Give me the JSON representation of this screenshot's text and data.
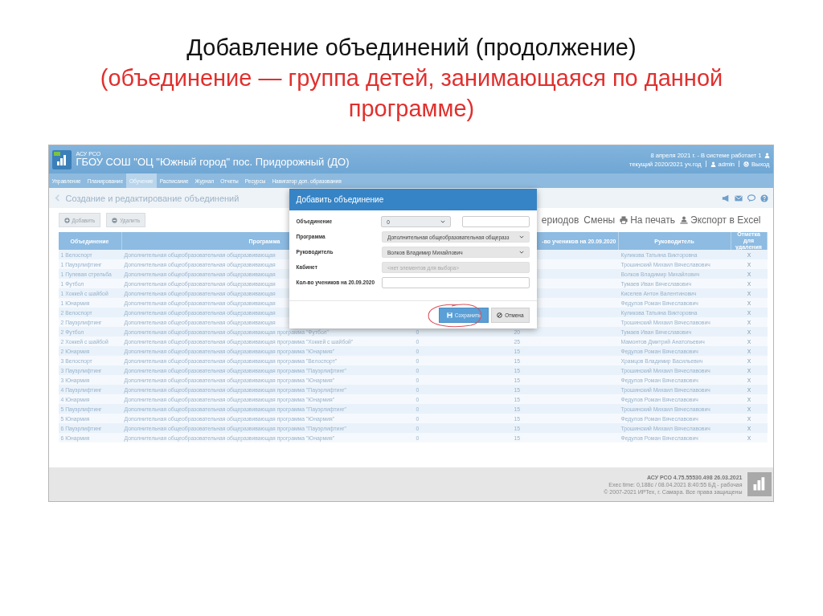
{
  "slide": {
    "title": "Добавление объединений (продолжение)",
    "subtitle": "(объединение — группа детей, занимающаяся по данной программе)"
  },
  "header": {
    "system": "АСУ РСО",
    "school": "ГБОУ СОШ \"ОЦ \"Южный город\" пос. Придорожный (ДО)",
    "status": "8 апреля 2021 г. - В системе работает 1",
    "year": "текущий 2020/2021 уч.год",
    "user": "admin",
    "logout": "Выход"
  },
  "nav": [
    {
      "label": "Управление",
      "selected": false
    },
    {
      "label": "Планирование",
      "selected": false
    },
    {
      "label": "Обучение",
      "selected": true
    },
    {
      "label": "Расписание",
      "selected": false
    },
    {
      "label": "Журнал",
      "selected": false
    },
    {
      "label": "Отчеты",
      "selected": false
    },
    {
      "label": "Ресурсы",
      "selected": false
    },
    {
      "label": "Навигатор доп. образования",
      "selected": false
    }
  ],
  "page_title": "Создание и редактирование объединений",
  "toolbar": {
    "buttons": [
      {
        "label": "Добавить",
        "kind": "add"
      },
      {
        "label": "Удалить",
        "kind": "remove"
      }
    ],
    "links": [
      {
        "label": "ериодов",
        "kind": "text"
      },
      {
        "label": "Смены",
        "kind": "text"
      },
      {
        "label": "На печать",
        "kind": "print"
      },
      {
        "label": "Экспорт в Excel",
        "kind": "export"
      }
    ]
  },
  "table": {
    "columns": {
      "name": "Объединение",
      "program": "Программа",
      "students": "-во учеников на 20.09.2020",
      "leader": "Руководитель",
      "mark": "Отметка для удаления"
    },
    "rows": [
      {
        "name": "1 Велоспорт",
        "program": "Дополнительная общеобразовательная общеразвивающая",
        "leader": "Куликова Татьяна Викторовна",
        "mark": "X"
      },
      {
        "name": "1 Пауэрлифтинг",
        "program": "Дополнительная общеобразовательная общеразвивающая",
        "leader": "Трошинский Михаил Вячеславович",
        "mark": "X"
      },
      {
        "name": "1 Пулевая стрельба",
        "program": "Дополнительная общеобразовательная общеразвивающая",
        "leader": "Волков Владимир Михайлович",
        "mark": "X"
      },
      {
        "name": "1 Футбол",
        "program": "Дополнительная общеобразовательная общеразвивающая",
        "leader": "Тумаев Иван Вячеславович",
        "mark": "X"
      },
      {
        "name": "1 Хоккей с шайбой",
        "program": "Дополнительная общеобразовательная общеразвивающая",
        "leader": "Киселев Антон Валентинович",
        "mark": "X"
      },
      {
        "name": "1 Юнармия",
        "program": "Дополнительная общеобразовательная общеразвивающая",
        "leader": "Федулов Роман Вячеславович",
        "mark": "X"
      },
      {
        "name": "2 Велоспорт",
        "program": "Дополнительная общеобразовательная общеразвивающая",
        "leader": "Куликова Татьяна Викторовна",
        "mark": "X"
      },
      {
        "name": "2 Пауэрлифтинг",
        "program": "Дополнительная общеобразовательная общеразвивающая",
        "leader": "Трошинский Михаил Вячеславович",
        "mark": "X"
      },
      {
        "name": "2 Футбол",
        "program": "Дополнительная общеобразовательная общеразвивающая программа \"Футбол\"",
        "column_3": "0",
        "students": "20",
        "leader": "Тумаев Иван Вячеславович",
        "mark": "X"
      },
      {
        "name": "2 Хоккей с шайбой",
        "program": "Дополнительная общеобразовательная общеразвивающая программа \"Хоккей с шайбой\"",
        "column_3": "0",
        "students": "25",
        "leader": "Мамонтов Дмитрий Анатольевич",
        "mark": "X"
      },
      {
        "name": "2 Юнармия",
        "program": "Дополнительная общеобразовательная общеразвивающая программа \"Юнармия\"",
        "column_3": "0",
        "students": "15",
        "leader": "Федулов Роман Вячеславович",
        "mark": "X"
      },
      {
        "name": "3 Велоспорт",
        "program": "Дополнительная общеобразовательная общеразвивающая программа \"Велоспорт\"",
        "column_3": "0",
        "students": "15",
        "leader": "Храмцов Владимир Васильевич",
        "mark": "X"
      },
      {
        "name": "3 Пауэрлифтинг",
        "program": "Дополнительная общеобразовательная общеразвивающая программа \"Пауэрлифтинг\"",
        "column_3": "0",
        "students": "15",
        "leader": "Трошинский Михаил Вячеславович",
        "mark": "X"
      },
      {
        "name": "3 Юнармия",
        "program": "Дополнительная общеобразовательная общеразвивающая программа \"Юнармия\"",
        "column_3": "0",
        "students": "15",
        "leader": "Федулов Роман Вячеславович",
        "mark": "X"
      },
      {
        "name": "4 Пауэрлифтинг",
        "program": "Дополнительная общеобразовательная общеразвивающая программа \"Пауэрлифтинг\"",
        "column_3": "0",
        "students": "15",
        "leader": "Трошинский Михаил Вячеславович",
        "mark": "X"
      },
      {
        "name": "4 Юнармия",
        "program": "Дополнительная общеобразовательная общеразвивающая программа \"Юнармия\"",
        "column_3": "0",
        "students": "15",
        "leader": "Федулов Роман Вячеславович",
        "mark": "X"
      },
      {
        "name": "5 Пауэрлифтинг",
        "program": "Дополнительная общеобразовательная общеразвивающая программа \"Пауэрлифтинг\"",
        "column_3": "0",
        "students": "15",
        "leader": "Трошинский Михаил Вячеславович",
        "mark": "X"
      },
      {
        "name": "5 Юнармия",
        "program": "Дополнительная общеобразовательная общеразвивающая программа \"Юнармия\"",
        "column_3": "0",
        "students": "15",
        "leader": "Федулов Роман Вячеславович",
        "mark": "X"
      },
      {
        "name": "6 Пауэрлифтинг",
        "program": "Дополнительная общеобразовательная общеразвивающая программа \"Пауэрлифтинг\"",
        "column_3": "0",
        "students": "15",
        "leader": "Трошинский Михаил Вячеславович",
        "mark": "X"
      },
      {
        "name": "6 Юнармия",
        "program": "Дополнительная общеобразовательная общеразвивающая программа \"Юнармия\"",
        "column_3": "0",
        "students": "15",
        "leader": "Федулов Роман Вячеславович",
        "mark": "X"
      }
    ]
  },
  "footer": {
    "lines": [
      "АСУ РСО 4.75.55530.498 26.03.2021",
      "Exec time: 0,188с / 08.04.2021 8:40:55 БД - рабочая",
      "© 2007-2021 ИРТех, г. Самара. Все права защищены"
    ]
  },
  "dialog": {
    "title": "Добавить объединение",
    "fields": [
      {
        "label": "Объединение",
        "kind": "select_text",
        "value": "0"
      },
      {
        "label": "Программа",
        "kind": "select",
        "value": "Дополнительная общеобразовательная общеразз"
      },
      {
        "label": "Руководитель",
        "kind": "select",
        "value": "Волков Владимир Михайлович"
      },
      {
        "label": "Кабинет",
        "kind": "disabled",
        "value": "<нет элементов для выбора>"
      },
      {
        "label": "Кол-во учеников на 20.09.2020",
        "kind": "text"
      }
    ],
    "save": "Сохранить",
    "cancel": "Отмена"
  }
}
